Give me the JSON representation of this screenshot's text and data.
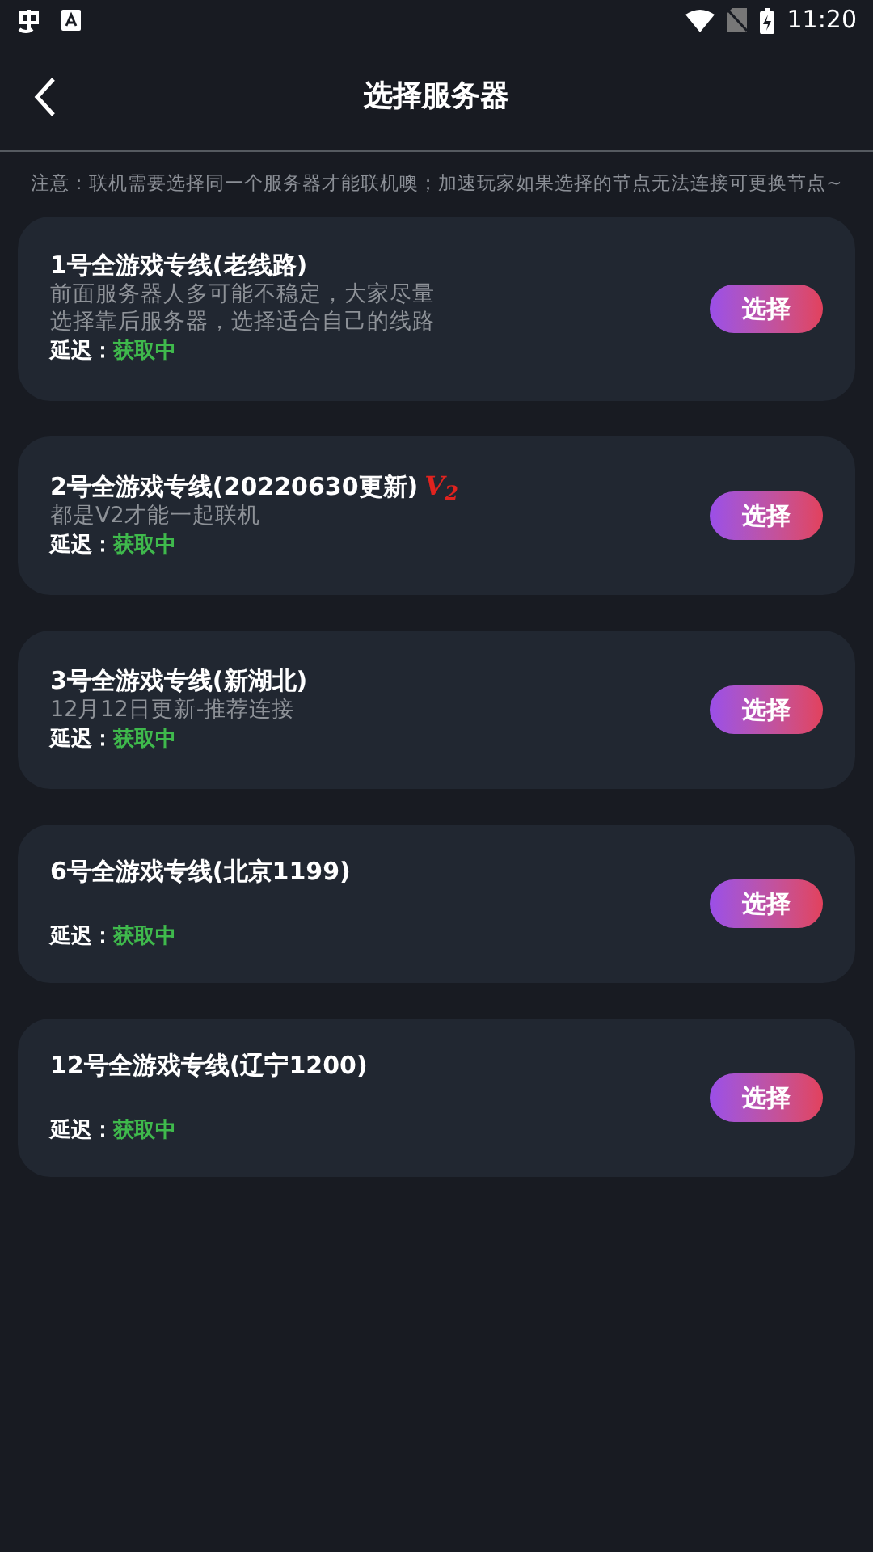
{
  "status_bar": {
    "time": "11:20"
  },
  "header": {
    "title": "选择服务器"
  },
  "notice": "注意：联机需要选择同一个服务器才能联机噢；加速玩家如果选择的节点无法连接可更换节点~",
  "servers": [
    {
      "name": "1号全游戏专线(老线路)",
      "description": [
        "前面服务器人多可能不稳定，大家尽量",
        "选择靠后服务器，选择适合自己的线路"
      ],
      "latency_label": "延迟：",
      "latency": "获取中",
      "button": "选择"
    },
    {
      "name": "2号全游戏专线(20220630更新)",
      "badge": "V$_{2}$",
      "description": [
        "都是V2才能一起联机"
      ],
      "latency_label": "延迟：",
      "latency": "获取中",
      "button": "选择"
    },
    {
      "name": "3号全游戏专线(新湖北)",
      "description": [
        "12月12日更新-推荐连接"
      ],
      "latency_label": "延迟：",
      "latency": "获取中",
      "button": "选择"
    },
    {
      "name": "6号全游戏专线(北京1199)",
      "latency_label": "延迟：",
      "latency": "获取中",
      "button": "选择"
    },
    {
      "name": "12号全游戏专线(辽宁1200)",
      "latency_label": "延迟：",
      "latency": "获取中",
      "button": "选择"
    }
  ]
}
